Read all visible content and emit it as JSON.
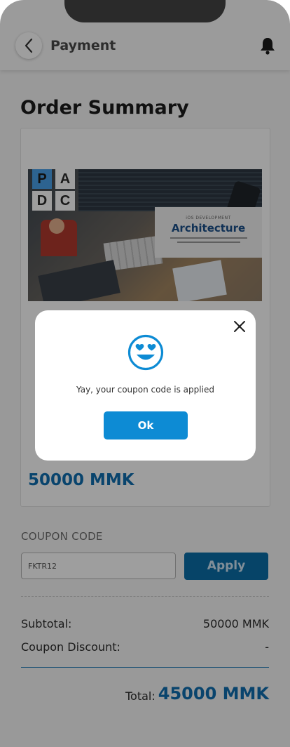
{
  "appbar": {
    "title": "Payment"
  },
  "order": {
    "title": "Order Summary"
  },
  "course": {
    "logo_letters": [
      "P",
      "A",
      "D",
      "C"
    ],
    "banner_subtitle": "iOS DEVELOPMENT",
    "banner_title": "Architecture",
    "price": "50000 MMK"
  },
  "coupon": {
    "label": "COUPON CODE",
    "value": "FKTR12",
    "apply_label": "Apply"
  },
  "summary": {
    "subtotal_label": "Subtotal:",
    "subtotal_value": "50000 MMK",
    "discount_label": "Coupon Discount:",
    "discount_value": "-",
    "total_label": "Total:",
    "total_value": "45000 MMK"
  },
  "dialog": {
    "message": "Yay, your coupon code is applied",
    "ok_label": "Ok"
  },
  "colors": {
    "accent": "#0d8bd4",
    "price": "#0f6fb1"
  }
}
